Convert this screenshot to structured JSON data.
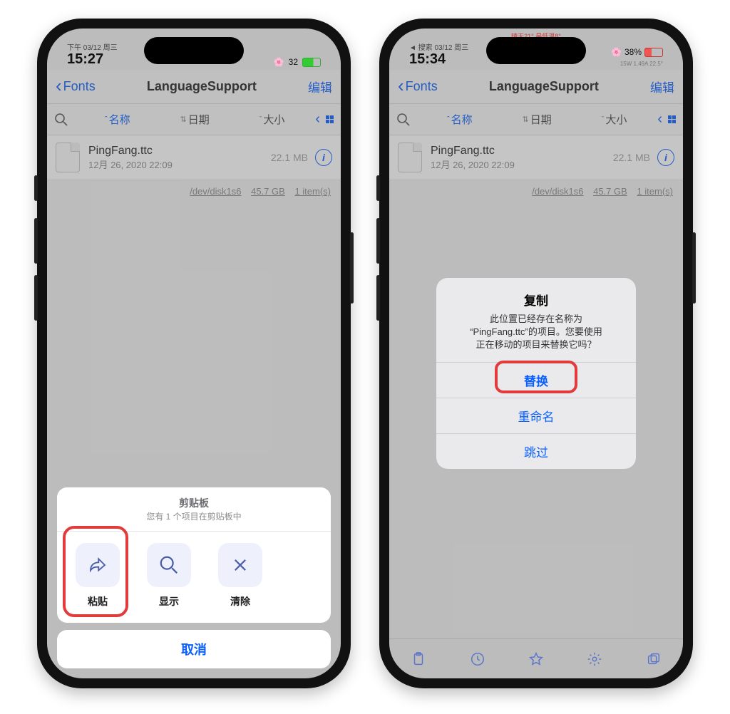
{
  "left": {
    "status": {
      "date": "下午 03/12 周三",
      "time": "15:27",
      "battery": "32"
    },
    "nav": {
      "back": "Fonts",
      "title": "LanguageSupport",
      "edit": "编辑"
    },
    "sort": {
      "name": "名称",
      "date": "日期",
      "size": "大小"
    },
    "file": {
      "name": "PingFang.ttc",
      "meta": "12月 26, 2020 22:09",
      "size": "22.1 MB"
    },
    "disk": {
      "dev": "/dev/disk1s6",
      "free": "45.7 GB",
      "items": "1 item(s)"
    },
    "sheet": {
      "title": "剪贴板",
      "subtitle": "您有 1 个项目在剪贴板中",
      "actions": {
        "paste": "粘贴",
        "show": "显示",
        "clear": "清除"
      },
      "cancel": "取消"
    }
  },
  "right": {
    "status": {
      "date": "◄ 搜索 03/12 周三",
      "time": "15:34",
      "battery": "38%",
      "extra": "晴天21°  最低温8°",
      "sub": "15W 1.49A 22.5°"
    },
    "nav": {
      "back": "Fonts",
      "title": "LanguageSupport",
      "edit": "编辑"
    },
    "sort": {
      "name": "名称",
      "date": "日期",
      "size": "大小"
    },
    "file": {
      "name": "PingFang.ttc",
      "meta": "12月 26, 2020 22:09",
      "size": "22.1 MB"
    },
    "disk": {
      "dev": "/dev/disk1s6",
      "free": "45.7 GB",
      "items": "1 item(s)"
    },
    "alert": {
      "title": "复制",
      "message": "此位置已经存在名称为\n“PingFang.ttc”的项目。您要使用\n正在移动的项目来替换它吗？",
      "replace": "替换",
      "rename": "重命名",
      "skip": "跳过"
    }
  }
}
